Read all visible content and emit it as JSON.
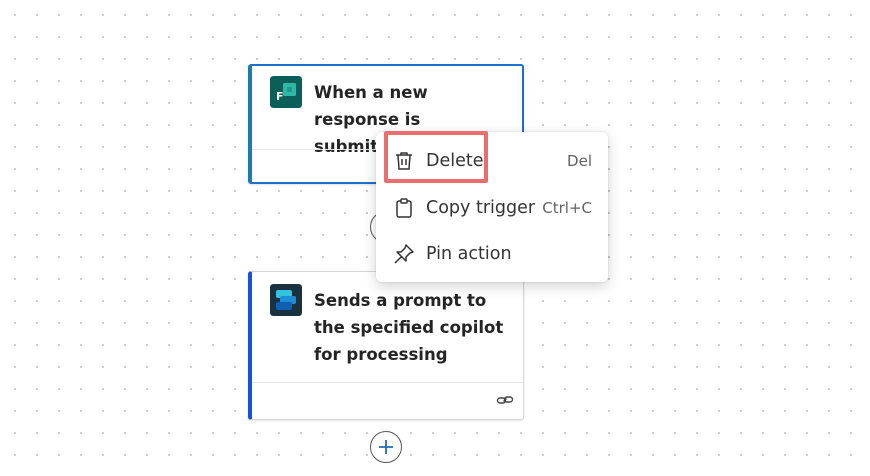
{
  "trigger_card": {
    "title": "When a new response is submitted",
    "icon": "microsoft-forms-icon",
    "accent_color": "#1f7ba8"
  },
  "action_card": {
    "title": "Sends a prompt to the specified copilot for processing",
    "icon": "copilot-studio-icon",
    "accent_color": "#1a4fd9",
    "footer_icon": "link-icon"
  },
  "context_menu": {
    "items": [
      {
        "label": "Delete",
        "shortcut": "Del",
        "icon": "trash-icon"
      },
      {
        "label": "Copy trigger",
        "shortcut": "Ctrl+C",
        "icon": "clipboard-icon"
      },
      {
        "label": "Pin action",
        "shortcut": "",
        "icon": "pin-icon"
      }
    ]
  },
  "add_step_icon": "plus-icon",
  "highlight_color": "#ea6e6e"
}
